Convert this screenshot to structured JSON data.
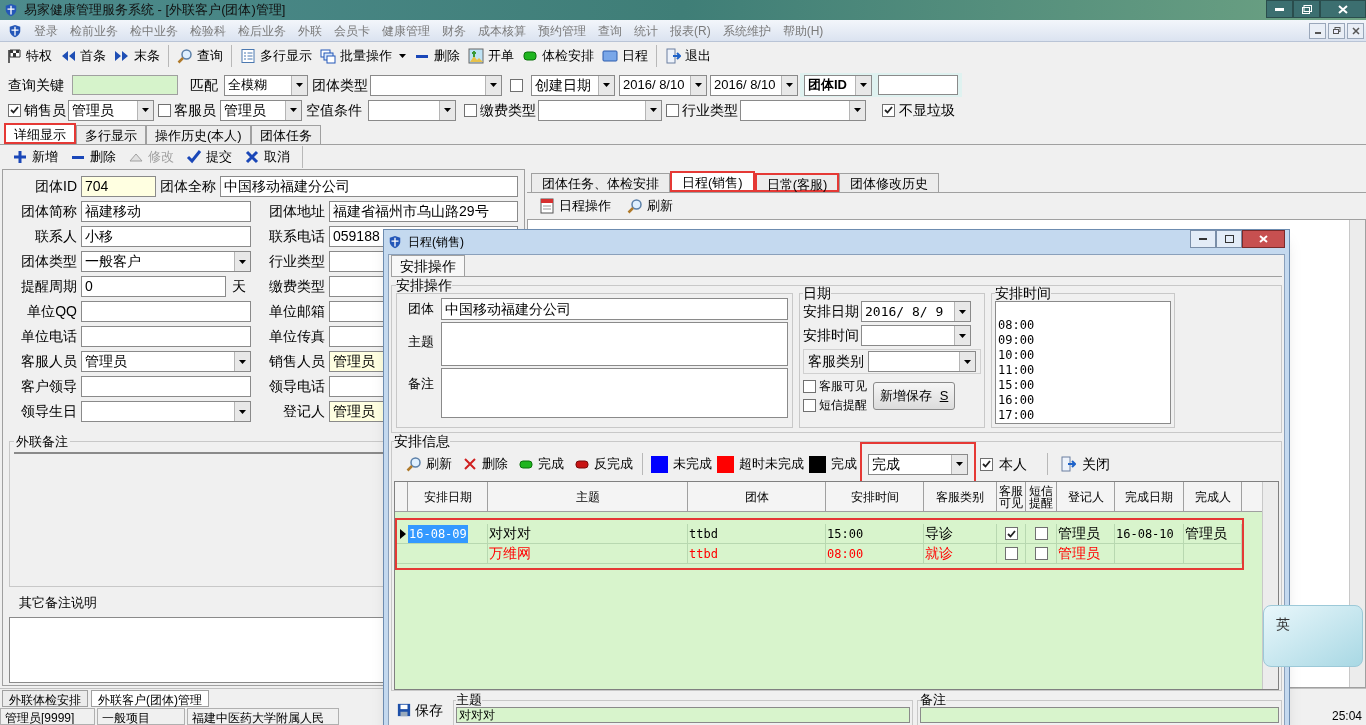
{
  "window": {
    "title": "易家健康管理服务系统 - [外联客户(团体)管理]"
  },
  "menu": [
    "登录",
    "检前业务",
    "检中业务",
    "检验科",
    "检后业务",
    "外联",
    "会员卡",
    "健康管理",
    "财务",
    "成本核算",
    "预约管理",
    "查询",
    "统计",
    "报表(R)",
    "系统维护",
    "帮助(H)"
  ],
  "toolbar": [
    [
      {
        "label": "特权",
        "kind": "privilege"
      },
      {
        "label": "首条",
        "kind": "first"
      },
      {
        "label": "末条",
        "kind": "last"
      }
    ],
    [
      {
        "label": "查询",
        "kind": "search"
      }
    ],
    [
      {
        "label": "多行显示",
        "kind": "list"
      },
      {
        "label": "批量操作",
        "kind": "batch"
      },
      {
        "label": "删除",
        "kind": "delete"
      },
      {
        "label": "开单",
        "kind": "order"
      },
      {
        "label": "体检安排",
        "kind": "exam"
      },
      {
        "label": "日程",
        "kind": "schedule"
      }
    ],
    [
      {
        "label": "退出",
        "kind": "exit"
      }
    ]
  ],
  "filters": {
    "query_key": {
      "label": "查询关键"
    },
    "match": {
      "label": "匹配",
      "value": "全模糊"
    },
    "group_type": {
      "label": "团体类型"
    },
    "date_filter": {
      "checked": false,
      "field": "创建日期",
      "from": "2016/ 8/10",
      "to": "2016/ 8/10"
    },
    "id_field": {
      "field": "团体ID"
    },
    "sales": {
      "checked": true,
      "label": "销售员",
      "value": "管理员"
    },
    "service": {
      "checked": false,
      "label": "客服员",
      "value": "管理员"
    },
    "empty_condition": {
      "label": "空值条件"
    },
    "fee_type": {
      "checked": false,
      "label": "缴费类型"
    },
    "industry_type": {
      "checked": false,
      "label": "行业类型"
    },
    "hide_trash": {
      "checked": true,
      "label": "不显垃圾"
    }
  },
  "tabs": [
    {
      "label": "详细显示",
      "selected": true,
      "highlighted": true
    },
    {
      "label": "多行显示",
      "selected": false,
      "highlighted": false
    },
    {
      "label": "操作历史(本人)",
      "selected": false,
      "highlighted": false
    },
    {
      "label": "团体任务",
      "selected": false,
      "highlighted": false
    }
  ],
  "edit_toolbar": [
    {
      "label": "新增",
      "kind": "add",
      "disabled": false
    },
    {
      "label": "删除",
      "kind": "delete",
      "disabled": false
    },
    {
      "label": "修改",
      "kind": "edit",
      "disabled": true
    },
    {
      "label": "提交",
      "kind": "submit",
      "disabled": false
    },
    {
      "label": "取消",
      "kind": "cancel",
      "disabled": false
    }
  ],
  "form": {
    "rows": [
      [
        {
          "label": "团体ID",
          "value": "704",
          "kind": "readonly"
        },
        {
          "label": "团体全称",
          "value": "中国移动福建分公司",
          "kind": "text"
        }
      ],
      [
        {
          "label": "团体简称",
          "value": "福建移动",
          "kind": "text"
        },
        {
          "label": "团体地址",
          "value": "福建省福州市乌山路29号",
          "kind": "text"
        }
      ],
      [
        {
          "label": "联系人",
          "value": "小移",
          "kind": "text"
        },
        {
          "label": "联系电话",
          "value": "059188",
          "kind": "text"
        }
      ],
      [
        {
          "label": "团体类型",
          "value": "一般客户",
          "kind": "combo"
        },
        {
          "label": "行业类型",
          "kind": "text"
        }
      ],
      [
        {
          "label": "提醒周期",
          "value": "0",
          "kind": "text",
          "suffix": "天"
        },
        {
          "label": "缴费类型",
          "kind": "text"
        }
      ],
      [
        {
          "label": "单位QQ",
          "kind": "text"
        },
        {
          "label": "单位邮箱",
          "kind": "text"
        }
      ],
      [
        {
          "label": "单位电话",
          "kind": "text"
        },
        {
          "label": "单位传真",
          "kind": "text"
        }
      ],
      [
        {
          "label": "客服人员",
          "value": "管理员",
          "kind": "combo"
        },
        {
          "label": "销售人员",
          "value": "管理员",
          "kind": "readonly"
        }
      ],
      [
        {
          "label": "客户领导",
          "kind": "text"
        },
        {
          "label": "领导电话",
          "kind": "text"
        }
      ],
      [
        {
          "label": "领导生日",
          "kind": "combo"
        },
        {
          "label": "登记人",
          "value": "管理员",
          "kind": "readonly"
        }
      ]
    ]
  },
  "remarks": {
    "label": "外联备注"
  },
  "other_remarks": {
    "label": "其它备注说明"
  },
  "detail_tabs": [
    {
      "label": "团体任务、体检安排",
      "selected": false,
      "highlighted": false
    },
    {
      "label": "日程(销售)",
      "selected": true,
      "highlighted": true
    },
    {
      "label": "日常(客服)",
      "selected": false,
      "highlighted": true
    },
    {
      "label": "团体修改历史",
      "selected": false,
      "highlighted": false
    }
  ],
  "detail_toolbar": [
    {
      "label": "日程操作",
      "kind": "calendar"
    },
    {
      "label": "刷新",
      "kind": "search"
    }
  ],
  "dialog": {
    "title": "日程(销售)",
    "tabs": [
      {
        "label": "安排操作",
        "selected": true
      }
    ],
    "group_title": "安排操作",
    "group_field": {
      "label": "团体",
      "value": "中国移动福建分公司"
    },
    "subject": {
      "label": "主题"
    },
    "note": {
      "label": "备注"
    },
    "date_group": {
      "title": "日期",
      "date": {
        "label": "安排日期",
        "value": "2016/ 8/ 9"
      },
      "time": {
        "label": "安排时间"
      },
      "category": {
        "label": "客服类别"
      },
      "checks": [
        {
          "label": "客服可见",
          "checked": false
        },
        {
          "label": "短信提醒",
          "checked": false
        }
      ],
      "save_button": {
        "label": "新增保存",
        "accelerator": "S"
      }
    },
    "time_group": {
      "title": "安排时间",
      "options": [
        "08:00",
        "09:00",
        "10:00",
        "11:00",
        "15:00",
        "16:00",
        "17:00"
      ]
    },
    "info_title": "安排信息",
    "toolbar": [
      {
        "label": "刷新",
        "kind": "search"
      },
      {
        "label": "删除",
        "kind": "cross"
      },
      {
        "label": "完成",
        "kind": "done"
      },
      {
        "label": "反完成",
        "kind": "undo"
      }
    ],
    "legend": [
      {
        "label": "未完成",
        "color": "#0000ff"
      },
      {
        "label": "超时未完成",
        "color": "#ff0000"
      },
      {
        "label": "完成",
        "color": "#000000"
      }
    ],
    "status_filter": {
      "value": "完成",
      "highlighted": true
    },
    "mine": {
      "label": "本人",
      "checked": true
    },
    "close": {
      "label": "关闭"
    },
    "grid": {
      "highlighted": true,
      "columns": [
        "安排日期",
        "主题",
        "团体",
        "安排时间",
        "客服类别",
        "客服可见",
        "短信提醒",
        "登记人",
        "完成日期",
        "完成人"
      ],
      "rows": [
        {
          "selected": true,
          "color": "#000000",
          "date": "16-08-09",
          "subject": "对对对",
          "group": "ttbd",
          "time": "15:00",
          "category": "导诊",
          "visible": true,
          "sms": false,
          "registrar": "管理员",
          "done_date": "16-08-10",
          "done_by": "管理员"
        },
        {
          "selected": false,
          "color": "#ff0000",
          "subject": "万维网",
          "group": "ttbd",
          "time": "08:00",
          "category": "就诊",
          "visible": false,
          "sms": false,
          "registrar": "管理员"
        }
      ]
    },
    "bottom": {
      "save": "保存",
      "subject": {
        "label": "主题",
        "value": "对对对"
      },
      "note": {
        "label": "备注"
      }
    }
  },
  "window_tabs": [
    {
      "label": "外联体检安排",
      "selected": false
    },
    {
      "label": "外联客户(团体)管理",
      "selected": true
    }
  ],
  "status_bar": [
    "管理员[9999]",
    "一般项目",
    "福建中医药大学附属人民",
    "25:04"
  ],
  "ime": {
    "label": "英"
  }
}
